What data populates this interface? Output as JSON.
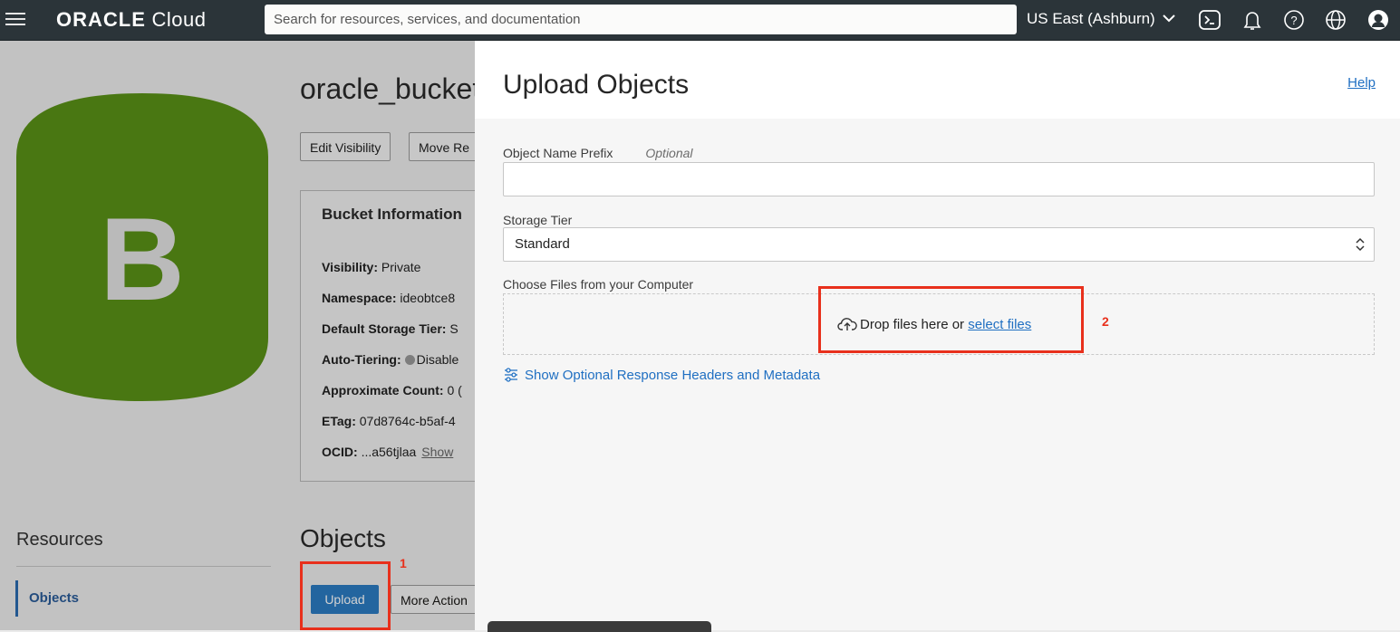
{
  "topbar": {
    "logo_bold": "ORACLE",
    "logo_light": "Cloud",
    "search_placeholder": "Search for resources, services, and documentation",
    "region": "US East (Ashburn)",
    "icons": [
      "menu-icon",
      "cloud-shell-icon",
      "bell-icon",
      "help-icon",
      "globe-icon",
      "user-icon"
    ]
  },
  "background": {
    "avatar_letter": "B",
    "avatar_color": "#5a9216",
    "title": "oracle_bucket",
    "buttons": {
      "edit_visibility": "Edit Visibility",
      "move_resource": "Move Re"
    },
    "bucket_info": {
      "heading": "Bucket Information",
      "rows": [
        {
          "key": "Visibility:",
          "value": "Private"
        },
        {
          "key": "Namespace:",
          "value": "ideobtce8"
        },
        {
          "key": "Default Storage Tier:",
          "value": "S"
        },
        {
          "key": "Auto-Tiering:",
          "value": "Disable"
        },
        {
          "key": "Approximate Count:",
          "value": "0 ("
        },
        {
          "key": "ETag:",
          "value": "07d8764c-b5af-4"
        },
        {
          "key": "OCID:",
          "value": "...a56tjlaa",
          "link": "Show"
        }
      ]
    },
    "resources_heading": "Resources",
    "resources_active_item": "Objects",
    "objects_heading": "Objects",
    "upload_button": "Upload",
    "more_actions_button": "More Action",
    "annotation_1": "1"
  },
  "panel": {
    "title": "Upload Objects",
    "help_link": "Help",
    "prefix_label": "Object Name Prefix",
    "prefix_optional": "Optional",
    "prefix_value": "",
    "storage_tier_label": "Storage Tier",
    "storage_tier_value": "Standard",
    "choose_files_label": "Choose Files from your Computer",
    "drop_text": "Drop files here or",
    "select_files_link": "select files",
    "annotation_2": "2",
    "show_optional_link": "Show Optional Response Headers and Metadata"
  },
  "colors": {
    "accent": "#2b7cc3",
    "annotation": "#e8301c",
    "topbar": "#2b3439"
  }
}
